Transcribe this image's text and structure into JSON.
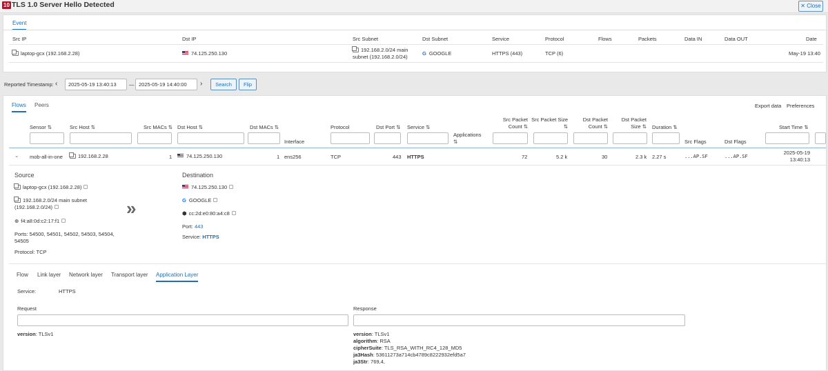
{
  "header": {
    "badge": "10",
    "title": "TLS 1.0 Server Hello Detected",
    "close_label": "Close"
  },
  "event": {
    "tab_label": "Event",
    "columns": [
      "Src IP",
      "Dst IP",
      "Src Subnet",
      "Dst Subnet",
      "Service",
      "Protocol",
      "Flows",
      "Packets",
      "Data IN",
      "Data OUT",
      "Date"
    ],
    "row": {
      "src_ip": "laptop-gcx (192.168.2.28)",
      "dst_ip": "74.125.250.130",
      "src_subnet_line1": "192.168.2.0/24 main",
      "src_subnet_line2": "subnet (192.168.2.0/24)",
      "dst_subnet": "GOOGLE",
      "service": "HTTPS (443)",
      "protocol": "TCP (6)",
      "date": "May-19 13:40"
    }
  },
  "filter": {
    "label": "Reported Timestamp:",
    "from": "2025-05-19 13:40:13",
    "dash": "—",
    "to": "2025-05-19 14:40:00",
    "search_label": "Search",
    "flip_label": "Flip"
  },
  "flows": {
    "tabs": [
      "Flows",
      "Peers"
    ],
    "export_label": "Export data",
    "preferences_label": "Preferences",
    "columns": {
      "sensor": "Sensor",
      "src_host": "Src Host",
      "src_macs": "Src MACs",
      "dst_host": "Dst Host",
      "dst_macs": "Dst MACs",
      "interface": "Interface",
      "protocol": "Protocol",
      "dst_port": "Dst Port",
      "service": "Service",
      "applications_1": "Applications",
      "src_pkt_count_1": "Src Packet",
      "src_pkt_count_2": "Count",
      "src_pkt_size": "Src Packet Size",
      "dst_pkt_count_1": "Dst Packet",
      "dst_pkt_count_2": "Count",
      "dst_pkt_size_1": "Dst Packet",
      "dst_pkt_size_2": "Size",
      "duration": "Duration",
      "src_flags": "Src Flags",
      "dst_flags": "Dst Flags",
      "start_time": "Start Time"
    },
    "row": {
      "sensor": "mob-all-in-one",
      "src_host": "192.168.2.28",
      "src_macs": "1",
      "dst_host": "74.125.250.130",
      "dst_macs": "1",
      "interface": "ens256",
      "protocol": "TCP",
      "dst_port": "443",
      "service": "HTTPS",
      "src_pkt_count": "72",
      "src_pkt_size": "5.2 k",
      "dst_pkt_count": "30",
      "dst_pkt_size": "2.3 k",
      "duration": "2.27 s",
      "src_flags": "...AP.SF",
      "dst_flags": "...AP.SF",
      "start_date": "2025-05-19",
      "start_clock": "13:40:13"
    }
  },
  "detail": {
    "source_title": "Source",
    "source_host": "laptop-gcx (192.168.2.28)",
    "source_subnet_1": "192.168.2.0/24 main subnet",
    "source_subnet_2": "(192.168.2.0/24)",
    "source_mac": "f4:a8:0d:c2:17:f1",
    "ports_label": "Ports: 54500, 54501, 54502, 54503, 54504,",
    "ports_cont": "54505",
    "protocol_line": "Protocol: TCP",
    "dest_title": "Destination",
    "dest_ip": "74.125.250.130",
    "dest_subnet": "GOOGLE",
    "dest_mac": "cc:2d:e0:80:a4:c8",
    "port_label": "Port:",
    "port_value": "443",
    "service_label": "Service:",
    "service_value": "HTTPS",
    "arrow": "»"
  },
  "layers": {
    "tabs": [
      "Flow",
      "Link layer",
      "Network layer",
      "Transport layer",
      "Application Layer"
    ],
    "service_label": "Service:",
    "service_value": "HTTPS",
    "request_title": "Request",
    "response_title": "Response",
    "request_fields": [
      {
        "k": "version",
        "v": "TLSv1"
      }
    ],
    "response_fields": [
      {
        "k": "version",
        "v": "TLSv1"
      },
      {
        "k": "algorithm",
        "v": "RSA"
      },
      {
        "k": "cipherSuite",
        "v": "TLS_RSA_WITH_RC4_128_MD5"
      },
      {
        "k": "ja3Hash",
        "v": "53611273a714cb4789c8222932efd5a7"
      },
      {
        "k": "ja3Str",
        "v": "769,4,"
      }
    ]
  }
}
